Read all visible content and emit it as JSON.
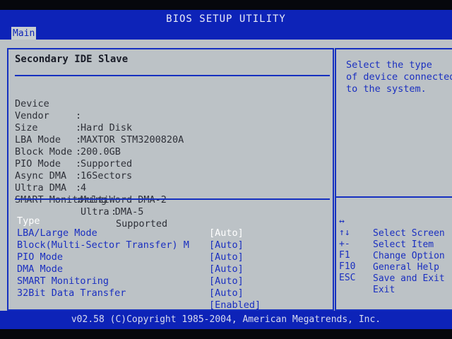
{
  "title": "BIOS SETUP UTILITY",
  "menu": {
    "active_tab": "Main"
  },
  "section_title": "Secondary IDE Slave",
  "device_info": [
    {
      "label": "Device",
      "sep": ":",
      "value": "Hard Disk"
    },
    {
      "label": "Vendor",
      "sep": ":",
      "value": "MAXTOR STM3200820A"
    },
    {
      "label": "Size",
      "sep": ":",
      "value": "200.0GB"
    },
    {
      "label": "LBA Mode",
      "sep": ":",
      "value": "Supported"
    },
    {
      "label": "Block Mode",
      "sep": ":",
      "value": "16Sectors"
    },
    {
      "label": "PIO Mode",
      "sep": ":",
      "value": "4"
    },
    {
      "label": "Async DMA",
      "sep": ":",
      "value": "MultiWord DMA-2"
    },
    {
      "label": "Ultra DMA",
      "sep": ":",
      "value": "Ultra DMA-5"
    },
    {
      "label": "SMART Monitoring",
      "sep": ":",
      "value": "Supported"
    }
  ],
  "settings": [
    {
      "label": "Type",
      "value": "[Auto]",
      "selected": true
    },
    {
      "label": "LBA/Large Mode",
      "value": "[Auto]"
    },
    {
      "label": "Block(Multi-Sector Transfer) M",
      "value": "[Auto]"
    },
    {
      "label": "PIO Mode",
      "value": "[Auto]"
    },
    {
      "label": "DMA Mode",
      "value": "[Auto]"
    },
    {
      "label": "SMART Monitoring",
      "value": "[Auto]"
    },
    {
      "label": "32Bit Data Transfer",
      "value": "[Enabled]"
    }
  ],
  "help": {
    "lines": [
      "Select the type",
      "of device connected",
      "to the system."
    ]
  },
  "keys": [
    {
      "glyph": "↔",
      "desc": "Select Screen"
    },
    {
      "glyph": "↑↓",
      "desc": "Select Item"
    },
    {
      "glyph": "+-",
      "desc": "Change Option"
    },
    {
      "glyph": "F1",
      "desc": "General Help"
    },
    {
      "glyph": "F10",
      "desc": "Save and Exit"
    },
    {
      "glyph": "ESC",
      "desc": "Exit"
    }
  ],
  "footer": "v02.58 (C)Copyright 1985-2004, American Megatrends, Inc.",
  "colors": {
    "bios_blue": "#0d23b8",
    "panel_gray": "#bcc2c6",
    "setting_text": "#1a2fc0",
    "selected_text": "#ffffff"
  }
}
